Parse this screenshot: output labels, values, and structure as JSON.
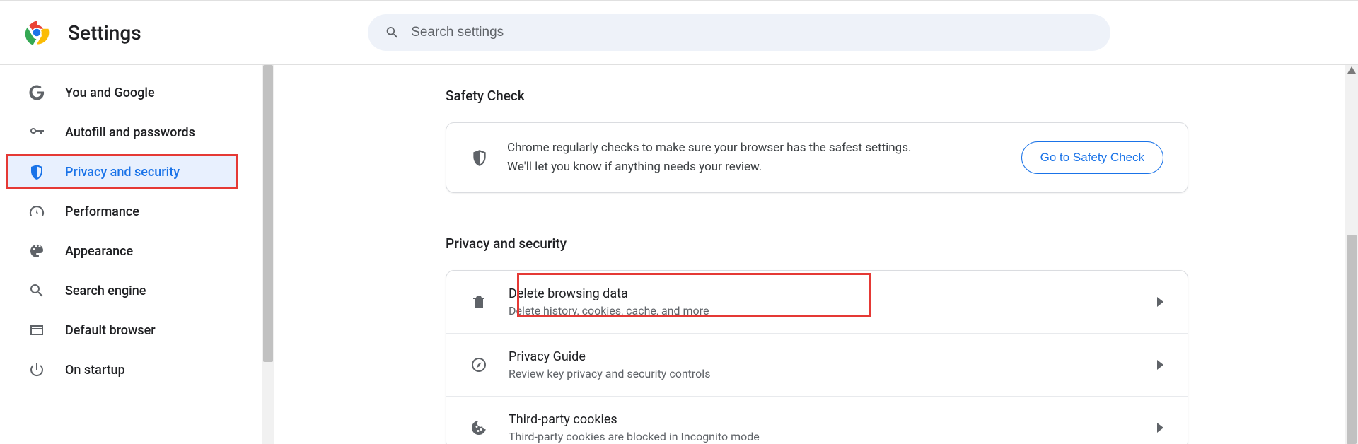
{
  "header": {
    "title": "Settings",
    "search_placeholder": "Search settings"
  },
  "sidebar": {
    "items": [
      {
        "id": "you-and-google",
        "label": "You and Google",
        "icon": "google-g"
      },
      {
        "id": "autofill",
        "label": "Autofill and passwords",
        "icon": "key"
      },
      {
        "id": "privacy",
        "label": "Privacy and security",
        "icon": "shield",
        "active": true,
        "highlighted": true
      },
      {
        "id": "performance",
        "label": "Performance",
        "icon": "speedometer"
      },
      {
        "id": "appearance",
        "label": "Appearance",
        "icon": "palette"
      },
      {
        "id": "search-engine",
        "label": "Search engine",
        "icon": "search"
      },
      {
        "id": "default-browser",
        "label": "Default browser",
        "icon": "browser"
      },
      {
        "id": "on-startup",
        "label": "On startup",
        "icon": "power"
      }
    ]
  },
  "main": {
    "safety_heading": "Safety Check",
    "safety_text_line1": "Chrome regularly checks to make sure your browser has the safest settings.",
    "safety_text_line2": "We'll let you know if anything needs your review.",
    "safety_button": "Go to Safety Check",
    "privacy_heading": "Privacy and security",
    "rows": [
      {
        "id": "delete-data",
        "title": "Delete browsing data",
        "sub": "Delete history, cookies, cache, and more",
        "icon": "trash",
        "highlighted": true
      },
      {
        "id": "privacy-guide",
        "title": "Privacy Guide",
        "sub": "Review key privacy and security controls",
        "icon": "compass"
      },
      {
        "id": "third-party-cookies",
        "title": "Third-party cookies",
        "sub": "Third-party cookies are blocked in Incognito mode",
        "icon": "cookie"
      }
    ]
  }
}
